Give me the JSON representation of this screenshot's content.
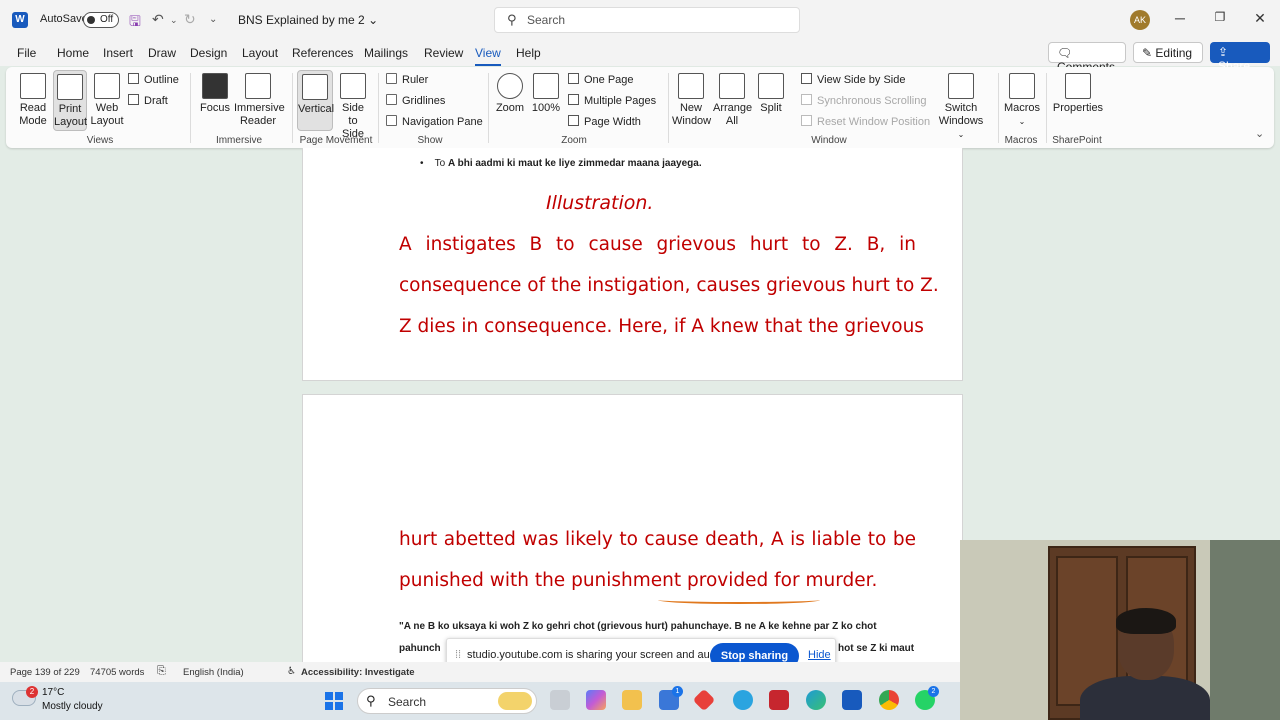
{
  "titlebar": {
    "autosave_label": "AutoSave",
    "autosave_state": "Off",
    "doc_title": "BNS Explained by me 2",
    "search_placeholder": "Search",
    "avatar_initials": "AK"
  },
  "menu": {
    "tabs": [
      "File",
      "Home",
      "Insert",
      "Draw",
      "Design",
      "Layout",
      "References",
      "Mailings",
      "Review",
      "View",
      "Help"
    ],
    "active": "View",
    "comments_label": "Comments",
    "editing_label": "Editing",
    "share_label": "Share"
  },
  "ribbon": {
    "views": {
      "label": "Views",
      "read_mode": [
        "Read",
        "Mode"
      ],
      "print_layout": [
        "Print",
        "Layout"
      ],
      "web_layout": [
        "Web",
        "Layout"
      ],
      "outline": "Outline",
      "draft": "Draft"
    },
    "immersive": {
      "label": "Immersive",
      "focus": "Focus",
      "immersive_reader": [
        "Immersive",
        "Reader"
      ]
    },
    "page_movement": {
      "label": "Page Movement",
      "vertical": "Vertical",
      "side_to_side": [
        "Side",
        "to Side"
      ]
    },
    "show": {
      "label": "Show",
      "ruler": "Ruler",
      "gridlines": "Gridlines",
      "navigation_pane": "Navigation Pane"
    },
    "zoom": {
      "label": "Zoom",
      "zoom": "Zoom",
      "hundred": "100%",
      "one_page": "One Page",
      "multiple_pages": "Multiple Pages",
      "page_width": "Page Width"
    },
    "window": {
      "label": "Window",
      "new_window": [
        "New",
        "Window"
      ],
      "arrange_all": [
        "Arrange",
        "All"
      ],
      "split": "Split",
      "view_side_by_side": "View Side by Side",
      "synchronous_scrolling": "Synchronous Scrolling",
      "reset_window_position": "Reset Window Position",
      "switch_windows": [
        "Switch",
        "Windows"
      ]
    },
    "macros": {
      "label": "Macros",
      "macros": "Macros"
    },
    "sharepoint": {
      "label": "SharePoint",
      "properties": "Properties"
    }
  },
  "document": {
    "bullet_prefix": "To ",
    "bullet_bold": "A bhi aadmi ki maut ke liye zimmedar maana jaayega.",
    "illustration": "Illustration.",
    "page1_lines": [
      "A instigates B to cause grievous hurt to Z. B, in",
      "consequence of the instigation, causes grievous hurt to Z.",
      "Z dies in consequence. Here, if A knew that the grievous"
    ],
    "page2_lines": [
      "hurt abetted was likely to cause death, A is liable to be",
      "punished with the punishment provided for murder."
    ],
    "hinglish_line1": "\"A ne B ko uksaya ki woh Z ko gehri chot (grievous hurt) pahunchaye. B ne A ke kehne par Z ko chot",
    "hinglish_line2_start": "pahunch",
    "hinglish_line2_end": "hot se Z ki maut"
  },
  "share_overlay": {
    "message": "studio.youtube.com is sharing your screen and audio.",
    "stop_label": "Stop sharing",
    "hide_label": "Hide"
  },
  "statusbar": {
    "page": "Page 139 of 229",
    "words": "74705 words",
    "language": "English (India)",
    "accessibility": "Accessibility: Investigate"
  },
  "taskbar": {
    "temperature": "17°C",
    "condition": "Mostly cloudy",
    "weather_badge": "2",
    "search_label": "Search",
    "store_badge": "1",
    "whatsapp_badge": "2"
  },
  "colors": {
    "accent": "#185abd",
    "doc_red": "#c00000",
    "underline": "#e0781e"
  }
}
